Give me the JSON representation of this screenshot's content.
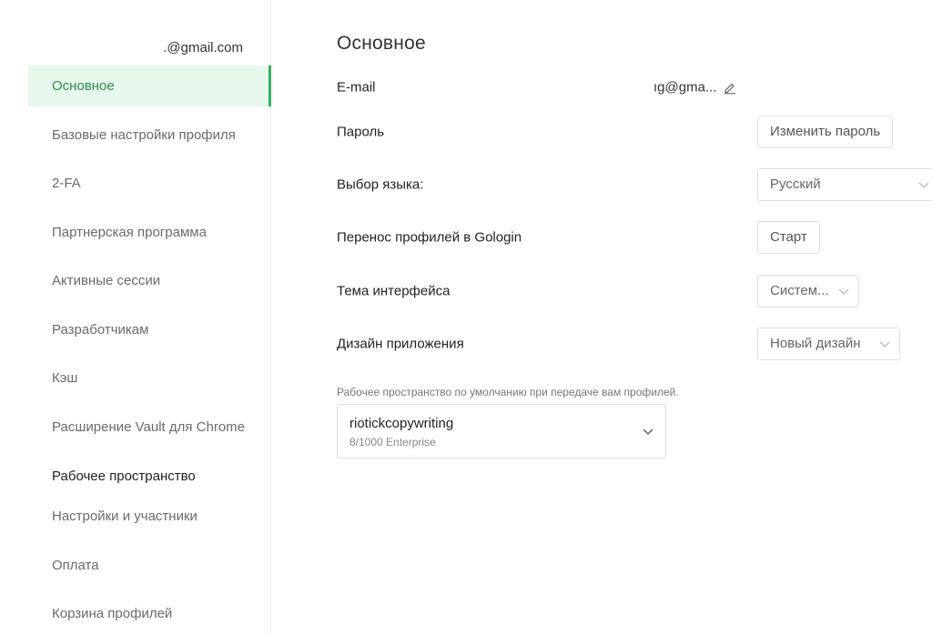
{
  "sidebar": {
    "account_email": ".@gmail.com",
    "items": [
      {
        "label": "Основное",
        "active": true
      },
      {
        "label": "Базовые настройки профиля"
      },
      {
        "label": "2-FA"
      },
      {
        "label": "Партнерская программа"
      },
      {
        "label": "Активные сессии"
      },
      {
        "label": "Разработчикам"
      },
      {
        "label": "Кэш"
      },
      {
        "label": "Расширение Vault для Chrome"
      }
    ],
    "group_title": "Рабочее пространство",
    "group_items": [
      {
        "label": "Настройки и участники"
      },
      {
        "label": "Оплата"
      },
      {
        "label": "Корзина профилей"
      }
    ]
  },
  "main": {
    "title": "Основное",
    "email": {
      "label": "E-mail",
      "value": "ıg@gma...",
      "edit_icon": "pencil-icon"
    },
    "password": {
      "label": "Пароль",
      "button": "Изменить пароль"
    },
    "language": {
      "label": "Выбор языка:",
      "value": "Русский"
    },
    "transfer": {
      "label": "Перенос профилей в Gologin",
      "button": "Старт"
    },
    "theme": {
      "label": "Тема интерфейса",
      "value": "Систем..."
    },
    "design": {
      "label": "Дизайн приложения",
      "value": "Новый дизайн"
    },
    "workspace": {
      "caption": "Рабочее пространство по умолчанию при передаче вам профилей.",
      "name": "riotickcopywriting",
      "sub": "8/1000 Enterprise"
    }
  },
  "colors": {
    "accent": "#2bb55b",
    "active_bg": "#e8f7ec",
    "active_text": "#2a8f4a"
  }
}
